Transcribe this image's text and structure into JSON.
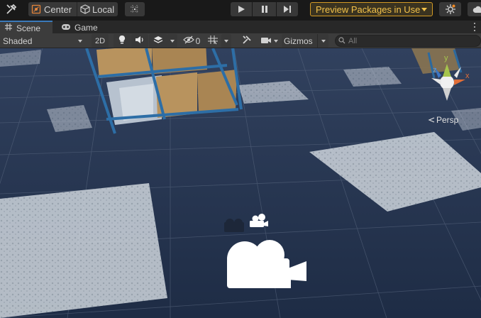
{
  "toolbar": {
    "center_label": "Center",
    "local_label": "Local",
    "preview_packages_label": "Preview Packages in Use",
    "accent_color": "#d29a25"
  },
  "tabs": [
    {
      "label": "Scene",
      "icon": "grid-icon",
      "active": true
    },
    {
      "label": "Game",
      "icon": "gamepad-icon",
      "active": false
    }
  ],
  "scene_toolbar": {
    "shading_mode": "Shaded",
    "toggle_2d_label": "2D",
    "hidden_count": "0",
    "gizmos_label": "Gizmos",
    "search_placeholder": "All"
  },
  "viewport": {
    "projection_label": "Persp",
    "axes": {
      "x": "x",
      "y": "y",
      "z": "z"
    }
  }
}
